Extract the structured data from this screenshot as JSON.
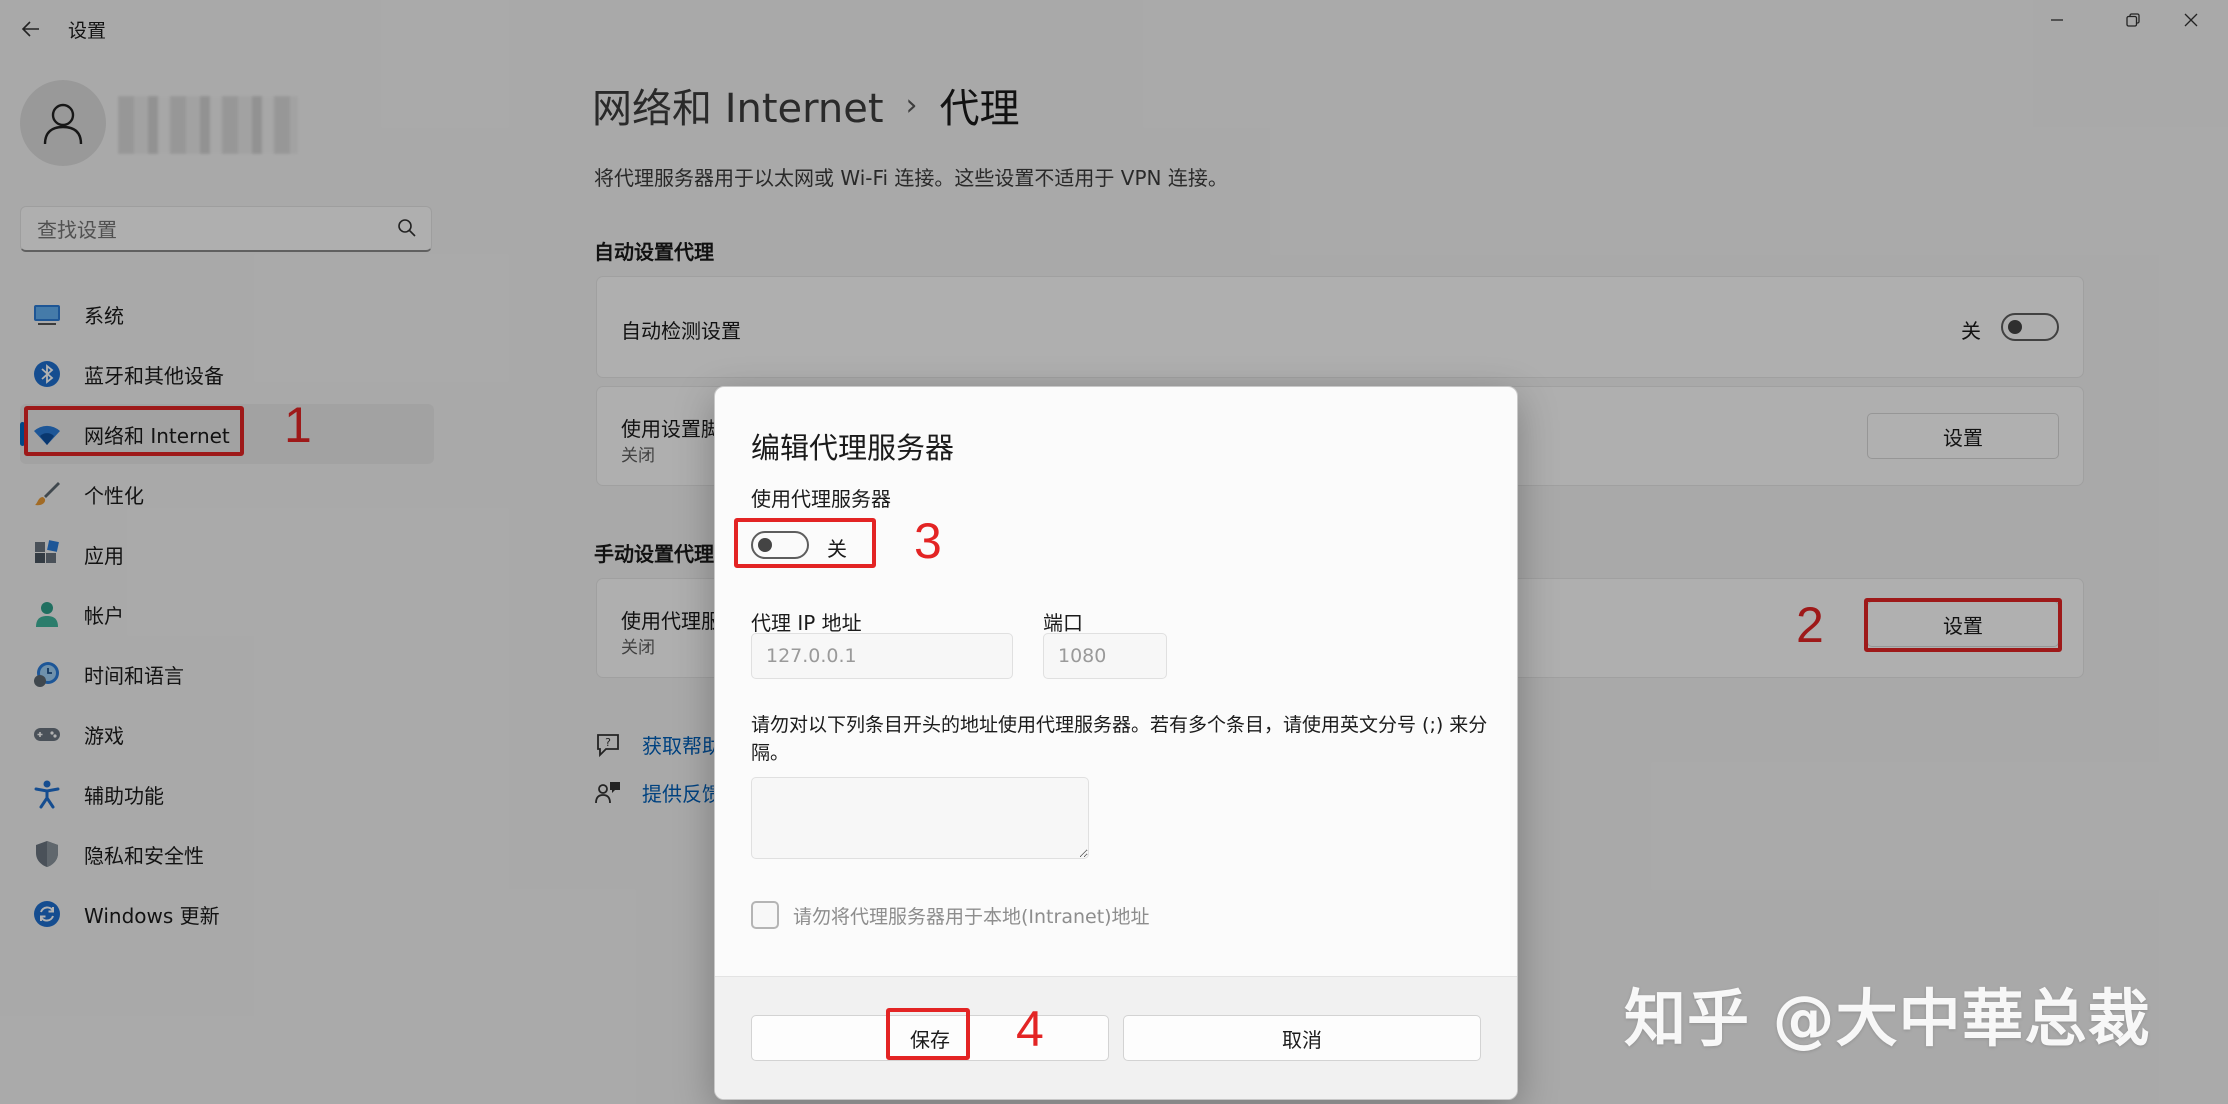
{
  "window": {
    "title": "设置"
  },
  "search": {
    "placeholder": "查找设置"
  },
  "sidebar": {
    "items": [
      {
        "label": "系统"
      },
      {
        "label": "蓝牙和其他设备"
      },
      {
        "label": "网络和 Internet"
      },
      {
        "label": "个性化"
      },
      {
        "label": "应用"
      },
      {
        "label": "帐户"
      },
      {
        "label": "时间和语言"
      },
      {
        "label": "游戏"
      },
      {
        "label": "辅助功能"
      },
      {
        "label": "隐私和安全性"
      },
      {
        "label": "Windows 更新"
      }
    ]
  },
  "main": {
    "breadcrumb_parent": "网络和 Internet",
    "breadcrumb_sep": "›",
    "title": "代理",
    "description": "将代理服务器用于以太网或 Wi-Fi 连接。这些设置不适用于 VPN 连接。",
    "auto_section": {
      "heading": "自动设置代理",
      "auto_detect_label": "自动检测设置",
      "auto_detect_state": "关",
      "script_label": "使用设置脚",
      "script_status": "关闭",
      "script_button": "设置"
    },
    "manual_section": {
      "heading": "手动设置代理",
      "proxy_label": "使用代理服",
      "proxy_status": "关闭",
      "proxy_button": "设置"
    },
    "links": {
      "help": "获取帮助",
      "feedback": "提供反馈"
    }
  },
  "dialog": {
    "title": "编辑代理服务器",
    "use_proxy_label": "使用代理服务器",
    "use_proxy_state": "关",
    "ip_label": "代理 IP 地址",
    "ip_value": "127.0.0.1",
    "port_label": "端口",
    "port_value": "1080",
    "exceptions_text": "请勿对以下列条目开头的地址使用代理服务器。若有多个条目，请使用英文分号 (;) 来分隔。",
    "exceptions_value": "",
    "local_checkbox_label": "请勿将代理服务器用于本地(Intranet)地址",
    "save_button": "保存",
    "cancel_button": "取消"
  },
  "annotations": [
    "1",
    "2",
    "3",
    "4"
  ],
  "watermark": "知乎 @大中華总裁",
  "colors": {
    "accent": "#0067c0",
    "annotation": "#e32424"
  }
}
